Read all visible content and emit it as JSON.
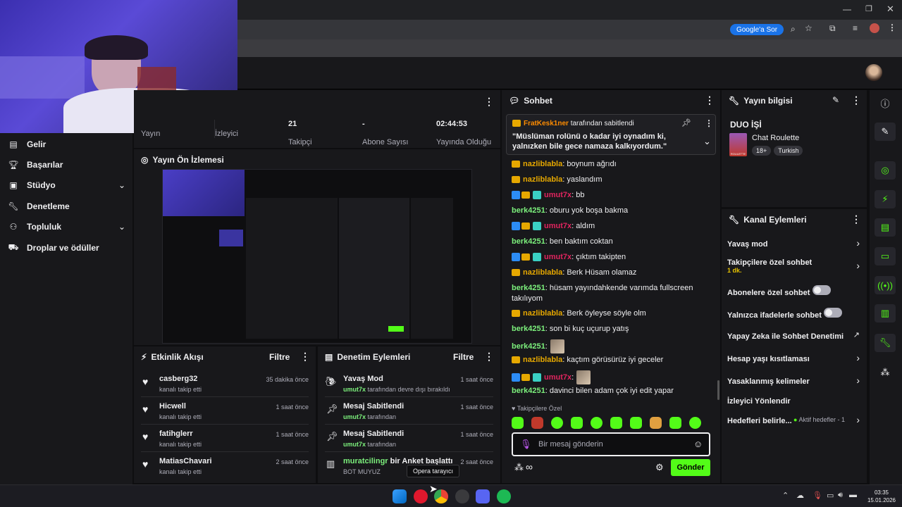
{
  "browser": {
    "google_ask": "Google'a Sor"
  },
  "stats": [
    {
      "value": "",
      "label": "Yayın"
    },
    {
      "value": "",
      "label": "İzleyici"
    },
    {
      "value": "21",
      "label": "Takipçi"
    },
    {
      "value": "-",
      "label": "Abone Sayısı"
    },
    {
      "value": "02:44:53",
      "label": "Yayında Olduğu"
    }
  ],
  "sidebar": {
    "items": [
      {
        "label": "Gelir",
        "icon": "chart-icon"
      },
      {
        "label": "Başarılar",
        "icon": "trophy-icon"
      },
      {
        "label": "Stüdyo",
        "icon": "studio-icon"
      },
      {
        "label": "Denetleme",
        "icon": "wrench-icon"
      },
      {
        "label": "Topluluk",
        "icon": "community-icon"
      },
      {
        "label": "Droplar ve ödüller",
        "icon": "gift-icon"
      }
    ]
  },
  "preview": {
    "title": "Yayın Ön İzlemesi"
  },
  "activity": {
    "title": "Etkinlik Akışı",
    "filter": "Filtre",
    "events": [
      {
        "user": "casberg32",
        "desc": "kanalı takip etti",
        "time": "35 dakika önce"
      },
      {
        "user": "Hicwell",
        "desc": "kanalı takip etti",
        "time": "1 saat önce"
      },
      {
        "user": "fatihglerr",
        "desc": "kanalı takip etti",
        "time": "1 saat önce"
      },
      {
        "user": "MatiasChavari",
        "desc": "kanalı takip etti",
        "time": "2 saat önce"
      }
    ]
  },
  "modactions": {
    "title": "Denetim Eylemleri",
    "filter": "Filtre",
    "events": [
      {
        "title": "Yavaş Mod",
        "user": "umut7x",
        "desc": " tarafından devre dışı bırakıldı",
        "time": "1 saat önce"
      },
      {
        "title": "Mesaj Sabitlendi",
        "user": "umut7x",
        "desc": " tarafından",
        "time": "1 saat önce"
      },
      {
        "title": "Mesaj Sabitlendi",
        "user": "umut7x",
        "desc": " tarafından",
        "time": "1 saat önce"
      },
      {
        "title_user": "muratcilingr",
        "title": " bir Anket başlattı",
        "user": "BOT MUYUZ",
        "desc": "",
        "time": "2 saat önce"
      }
    ],
    "tooltip": "Opera tarayıcı"
  },
  "chat": {
    "title": "Sohbet",
    "pinned_by": "FratKesk1ner",
    "pinned_suffix": " tarafından sabitlendi",
    "pinned_text": "\"Müslüman rolünü o kadar iyi oynadım ki, yalnızken bile gece namaza kalkıyordum.\"",
    "messages": [
      {
        "user": "nazliblabla",
        "text": ": boynum ağrıdı",
        "badges": "crown",
        "color": "#e6a800"
      },
      {
        "user": "nazliblabla",
        "text": ": yaslandım",
        "badges": "crown",
        "color": "#e6a800"
      },
      {
        "user": "umut7x",
        "text": ": bb",
        "badges": "modvip",
        "color": "#e0245e"
      },
      {
        "user": "berk4251",
        "text": ": oburu yok boşa bakma",
        "badges": "",
        "color": "#7cf07c"
      },
      {
        "user": "umut7x",
        "text": ": aldım",
        "badges": "modvip",
        "color": "#e0245e"
      },
      {
        "user": "berk4251",
        "text": ": ben baktım coktan",
        "badges": "",
        "color": "#7cf07c"
      },
      {
        "user": "umut7x",
        "text": ": çıktım takipten",
        "badges": "modvip",
        "color": "#e0245e"
      },
      {
        "user": "nazliblabla",
        "text": ": Berk Hüsam olamaz",
        "badges": "crown",
        "color": "#e6a800"
      },
      {
        "user": "berk4251",
        "text": ": hüsam yayındahkende varımda fullscreen takılıyom",
        "badges": "",
        "color": "#7cf07c"
      },
      {
        "user": "nazliblabla",
        "text": ": Berk öyleyse söyle olm",
        "badges": "crown",
        "color": "#e6a800"
      },
      {
        "user": "berk4251",
        "text": ": son bi kuç uçurup yatış",
        "badges": "",
        "color": "#7cf07c"
      },
      {
        "user": "berk4251",
        "text": ":",
        "badges": "",
        "color": "#7cf07c",
        "emote": true
      },
      {
        "user": "nazliblabla",
        "text": ": kaçtım görüsürüz iyi geceler",
        "badges": "crown",
        "color": "#e6a800"
      },
      {
        "user": "umut7x",
        "text": ":",
        "badges": "modvip",
        "color": "#e0245e",
        "emote": true
      },
      {
        "user": "berk4251",
        "text": ": davinci bilen adam çok iyi edit yapar",
        "badges": "",
        "color": "#7cf07c"
      }
    ],
    "followers_only": "Takipçilere Özel",
    "placeholder": "Bir mesaj gönderin",
    "send": "Gönder"
  },
  "streaminfo": {
    "title": "Yayın bilgisi",
    "stream_title": "DUO İŞİ",
    "category": "Chat Roulette",
    "tags": [
      "18+",
      "Turkish"
    ],
    "category_thumb_label": "ROULETTE"
  },
  "channel_actions": {
    "title": "Kanal Eylemleri",
    "items": [
      {
        "label": "Yavaş mod",
        "control": "chevron"
      },
      {
        "label": "Takipçilere özel sohbet",
        "sub": "1 dk.",
        "control": "chevron"
      },
      {
        "label": "Abonelere özel sohbet",
        "control": "toggle"
      },
      {
        "label": "Yalnızca ifadelerle sohbet",
        "control": "toggle"
      },
      {
        "label": "Yapay Zeka ile Sohbet Denetimi",
        "control": "external"
      },
      {
        "label": "Hesap yaşı kısıtlaması",
        "control": "chevron"
      },
      {
        "label": "Yasaklanmış kelimeler",
        "control": "chevron"
      },
      {
        "label": "İzleyici Yönlendir",
        "control": "none"
      },
      {
        "label": "Hedefleri belirle...",
        "sub": "Aktif hedefler - 1",
        "control": "chevron"
      }
    ]
  },
  "taskbar": {
    "time": "03:35",
    "date": "15.01.2026"
  },
  "colors": {
    "accent_green": "#53fc18",
    "bg": "#0e0e10",
    "panel": "#18181b"
  }
}
